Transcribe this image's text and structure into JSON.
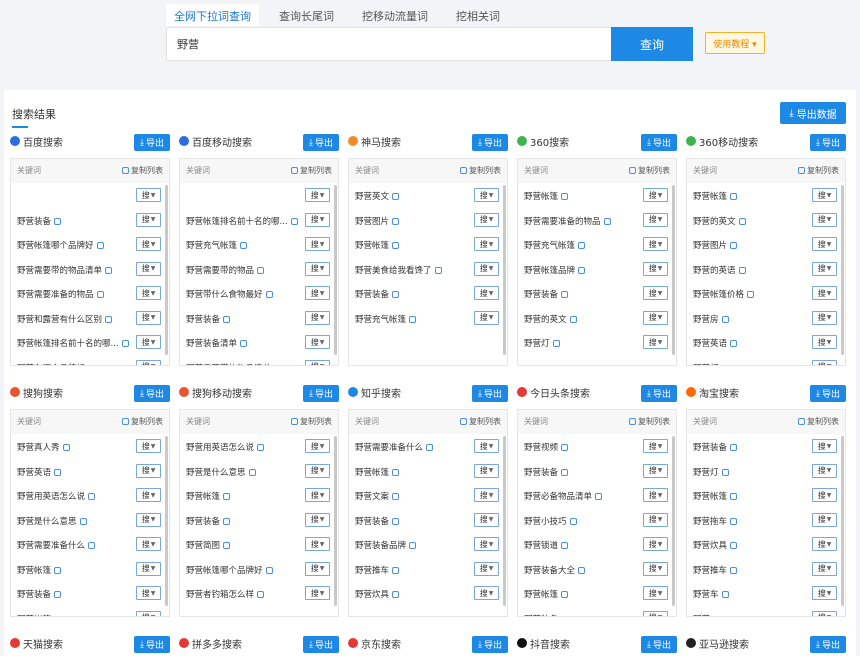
{
  "top_tabs": [
    "全网下拉词查询",
    "查询长尾词",
    "挖移动流量词",
    "挖相关词"
  ],
  "search_value": "野营",
  "search_button": "查询",
  "tutorial_button": "使用教程 ▾",
  "results_title": "搜索结果",
  "export_all": "导出数据",
  "export_label": "导出",
  "keyword_header": "关键词",
  "copy_list": "复制列表",
  "sou_label": "搜",
  "engines": [
    {
      "name": "百度搜索",
      "color": "#2d6be0",
      "rows": [
        "",
        "野营装备",
        "野营帐篷哪个品牌好",
        "野营需要带的物品清单",
        "野营需要准备的物品",
        "野营和露营有什么区别",
        "野营帐篷排名前十名的哪...",
        "野营车哪个品牌好"
      ]
    },
    {
      "name": "百度移动搜索",
      "color": "#2d6be0",
      "rows": [
        "",
        "野营帐篷排名前十名的哪...",
        "野营充气帐篷",
        "野营需要带的物品",
        "野营带什么食物最好",
        "野营装备",
        "野营装备清单",
        "野营需要带的物品清单"
      ]
    },
    {
      "name": "神马搜索",
      "color": "#f28c28",
      "rows": [
        "野营英文",
        "野营图片",
        "野营帐篷",
        "野营美食给我看馋了",
        "野营装备",
        "野营充气帐篷"
      ]
    },
    {
      "name": "360搜索",
      "color": "#3fb34f",
      "rows": [
        "野营帐篷",
        "野营需要准备的物品",
        "野营充气帐篷",
        "野营帐篷品牌",
        "野营装备",
        "野营的英文",
        "野营灯"
      ]
    },
    {
      "name": "360移动搜索",
      "color": "#3fb34f",
      "rows": [
        "野营帐篷",
        "野营的英文",
        "野营图片",
        "野营的英语",
        "野营帐篷价格",
        "野营房",
        "野营英语",
        "野营灯"
      ]
    },
    {
      "name": "搜狗搜索",
      "color": "#e8542f",
      "rows": [
        "野营真人秀",
        "野营英语",
        "野营用英语怎么说",
        "野营是什么意思",
        "野营需要准备什么",
        "野营帐篷",
        "野营装备",
        "野营帐篷"
      ]
    },
    {
      "name": "搜狗移动搜索",
      "color": "#e8542f",
      "rows": [
        "野营用英语怎么说",
        "野营是什么意思",
        "野营帐篷",
        "野营装备",
        "野营简图",
        "野营帐篷哪个品牌好",
        "野营者钓箱怎么样"
      ]
    },
    {
      "name": "知乎搜索",
      "color": "#1e88e5",
      "rows": [
        "野营需要准备什么",
        "野营帐篷",
        "野营文案",
        "野营装备",
        "野营装备品牌",
        "野营推车",
        "野营炊具"
      ]
    },
    {
      "name": "今日头条搜索",
      "color": "#e53935",
      "rows": [
        "野营视频",
        "野营装备",
        "野营必备物品清单",
        "野营小技巧",
        "野营锁道",
        "野营装备大全",
        "野营帐篷",
        "野营装备"
      ]
    },
    {
      "name": "淘宝搜索",
      "color": "#ff6a00",
      "rows": [
        "野营装备",
        "野营灯",
        "野营帐篷",
        "野营拖车",
        "野营炊具",
        "野营推车",
        "野营车",
        "野营"
      ]
    },
    {
      "name": "天猫搜索",
      "color": "#e53935",
      "rows": []
    },
    {
      "name": "拼多多搜索",
      "color": "#e53935",
      "rows": []
    },
    {
      "name": "京东搜索",
      "color": "#e53935",
      "rows": []
    },
    {
      "name": "抖音搜索",
      "color": "#111111",
      "rows": []
    },
    {
      "name": "亚马逊搜索",
      "color": "#222222",
      "rows": []
    }
  ]
}
